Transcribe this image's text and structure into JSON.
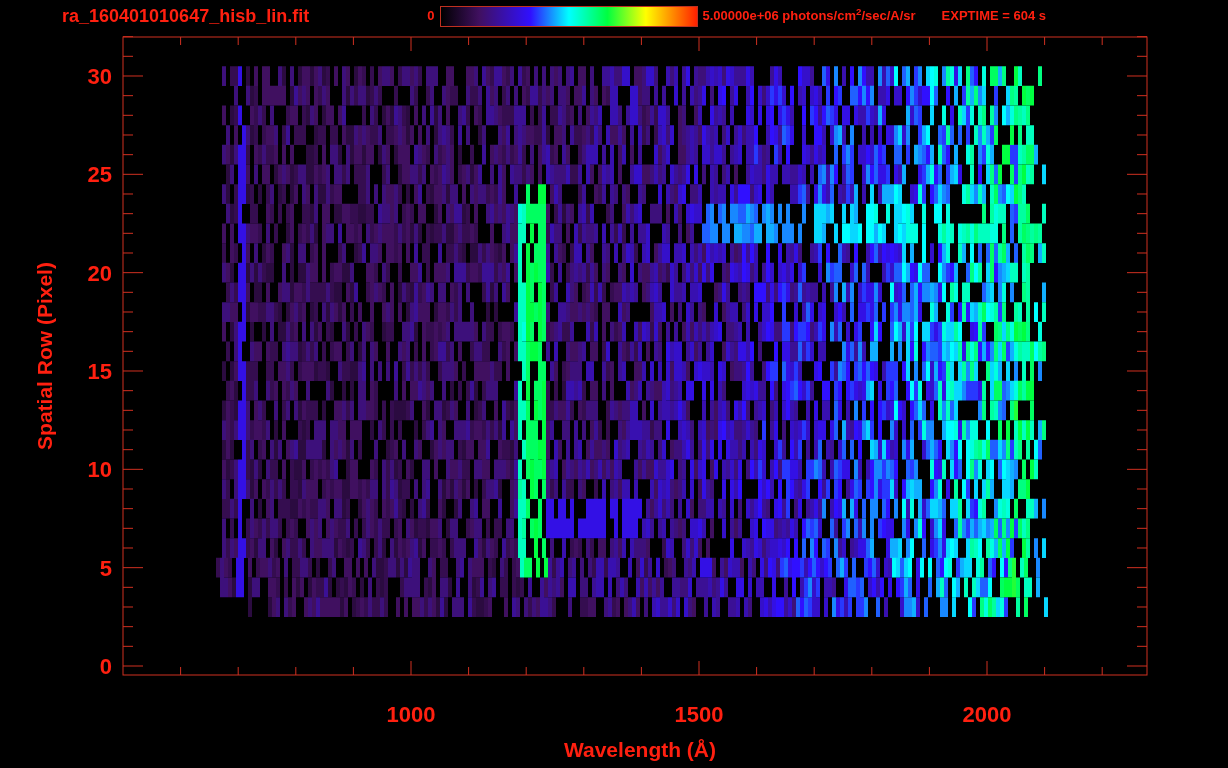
{
  "title": "ra_160401010647_hisb_lin.fit",
  "colorbar": {
    "min_label": "0",
    "max_label": "5.00000e+06 photons/cm$^{2}$/sec/A/sr"
  },
  "exposure": "EXPTIME = 604 s",
  "plot": {
    "xlabel": "Wavelength (Å)",
    "ylabel": "Spatial Row (Pixel)",
    "xticks": [
      "1000",
      "1500",
      "2000"
    ],
    "yticks": [
      "30",
      "25",
      "20",
      "15",
      "10",
      "5",
      "0"
    ]
  }
}
